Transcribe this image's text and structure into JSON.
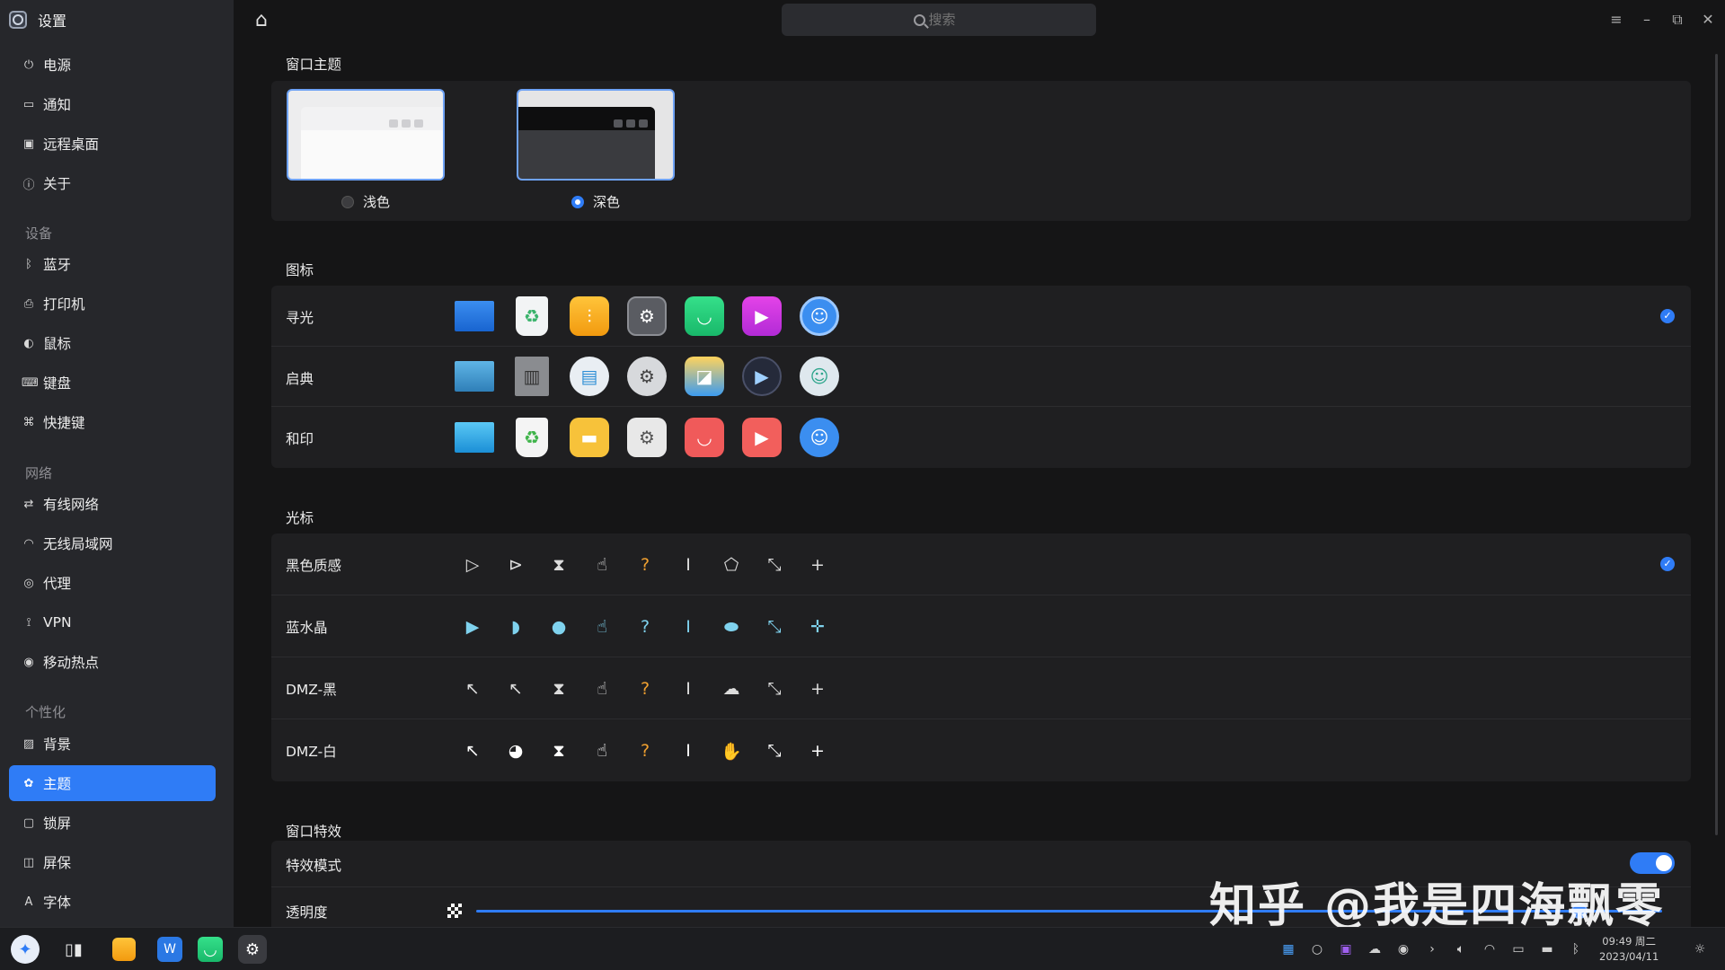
{
  "app": {
    "title": "设置"
  },
  "sidebar": {
    "groups": {
      "system_items": [
        {
          "label": "电源",
          "icon": "power-icon"
        },
        {
          "label": "通知",
          "icon": "chat-bubble-icon"
        },
        {
          "label": "远程桌面",
          "icon": "remote-desktop-icon"
        },
        {
          "label": "关于",
          "icon": "info-icon"
        }
      ],
      "devices_label": "设备",
      "devices_items": [
        {
          "label": "蓝牙",
          "icon": "bluetooth-icon"
        },
        {
          "label": "打印机",
          "icon": "printer-icon"
        },
        {
          "label": "鼠标",
          "icon": "mouse-icon"
        },
        {
          "label": "键盘",
          "icon": "keyboard-icon"
        },
        {
          "label": "快捷键",
          "icon": "shortcut-icon"
        }
      ],
      "network_label": "网络",
      "network_items": [
        {
          "label": "有线网络",
          "icon": "wired-network-icon"
        },
        {
          "label": "无线局域网",
          "icon": "wifi-icon"
        },
        {
          "label": "代理",
          "icon": "proxy-icon"
        },
        {
          "label": "VPN",
          "icon": "vpn-icon"
        },
        {
          "label": "移动热点",
          "icon": "hotspot-icon"
        }
      ],
      "personal_label": "个性化",
      "personal_items": [
        {
          "label": "背景",
          "icon": "image-icon"
        },
        {
          "label": "主题",
          "icon": "palette-icon",
          "active": true
        },
        {
          "label": "锁屏",
          "icon": "lock-screen-icon"
        },
        {
          "label": "屏保",
          "icon": "screensaver-icon"
        },
        {
          "label": "字体",
          "icon": "font-icon"
        }
      ]
    }
  },
  "header": {
    "search_placeholder": "搜索"
  },
  "window_theme": {
    "title": "窗口主题",
    "options": [
      {
        "label": "浅色",
        "selected": false
      },
      {
        "label": "深色",
        "selected": true
      }
    ]
  },
  "icons": {
    "title": "图标",
    "themes": [
      {
        "label": "寻光",
        "selected": true,
        "icons": [
          "computer-icon",
          "recycle-bin-icon",
          "file-manager-icon",
          "settings-icon",
          "software-store-icon",
          "video-player-icon",
          "assistant-icon"
        ]
      },
      {
        "label": "启典",
        "selected": false,
        "icons": [
          "computer-icon",
          "trash-icon",
          "file-manager-icon",
          "settings-icon",
          "software-store-icon",
          "video-player-icon",
          "assistant-icon"
        ]
      },
      {
        "label": "和印",
        "selected": false,
        "icons": [
          "computer-icon",
          "recycle-bin-icon",
          "file-manager-icon",
          "settings-icon",
          "software-store-icon",
          "video-player-icon",
          "assistant-icon"
        ]
      }
    ]
  },
  "cursor": {
    "title": "光标",
    "themes": [
      {
        "label": "黑色质感",
        "selected": true,
        "style": "dark"
      },
      {
        "label": "蓝水晶",
        "selected": false,
        "style": "blue"
      },
      {
        "label": "DMZ-黑",
        "selected": false,
        "style": "dark"
      },
      {
        "label": "DMZ-白",
        "selected": false,
        "style": "white"
      }
    ]
  },
  "window_effects": {
    "title": "窗口特效",
    "effect_mode_label": "特效模式",
    "effect_mode_on": true,
    "transparency_label": "透明度",
    "transparency_value": 0.93
  },
  "watermark": "知乎 @我是四海飘零",
  "taskbar": {
    "time": "09:49 周二",
    "date": "2023/04/11"
  },
  "colors": {
    "accent": "#2f7cf6",
    "sidebar_bg": "#26272b",
    "panel_bg": "#1f1f21",
    "page_bg": "#151516"
  }
}
